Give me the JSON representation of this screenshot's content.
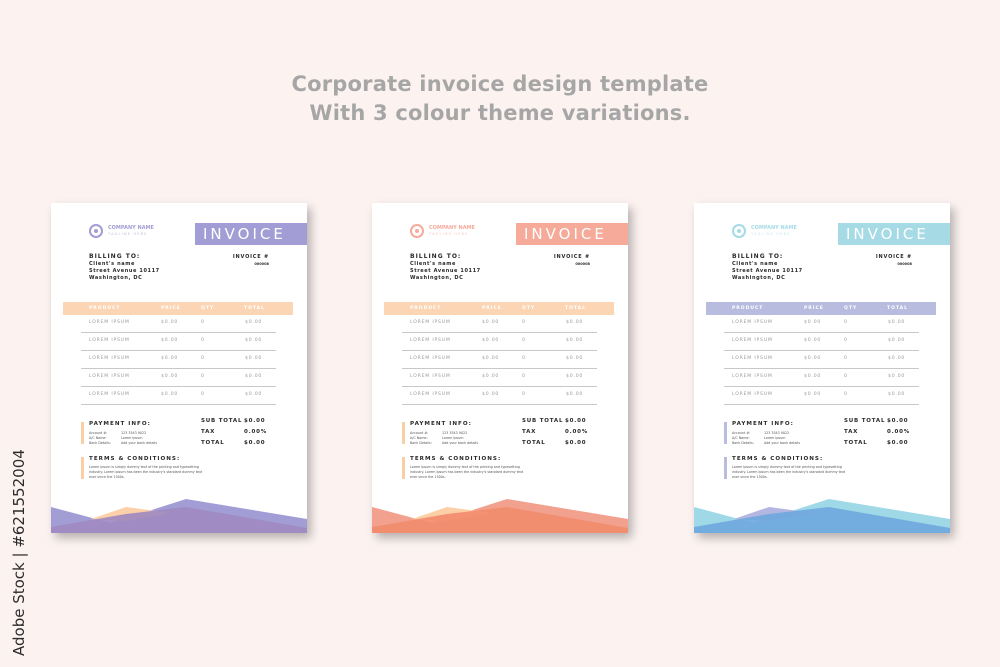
{
  "headline": {
    "line1": "Corporate invoice design template",
    "line2": "With 3 colour theme variations."
  },
  "credit": "Adobe Stock | #621552004",
  "invoice_common": {
    "company_name": "COMPANY NAME",
    "tagline": "TAGLINE HERE",
    "banner_title": "INVOICE",
    "billing_title": "BILLING TO:",
    "billing_lines": [
      "Client's name",
      "Street Avenue 10117",
      "Washington, DC"
    ],
    "invoice_no_label": "INVOICE #",
    "invoice_no_value": "000008",
    "table_headers": [
      "PRODUCT",
      "PRICE",
      "QTY",
      "TOTAL"
    ],
    "rows": [
      [
        "LOREM IPSUM",
        "$0.00",
        "0",
        "$0.00"
      ],
      [
        "LOREM IPSUM",
        "$0.00",
        "0",
        "$0.00"
      ],
      [
        "LOREM IPSUM",
        "$0.00",
        "0",
        "$0.00"
      ],
      [
        "LOREM IPSUM",
        "$0.00",
        "0",
        "$0.00"
      ],
      [
        "LOREM IPSUM",
        "$0.00",
        "0",
        "$0.00"
      ]
    ],
    "payment_title": "PAYMENT INFO:",
    "payment": [
      {
        "k": "Account #:",
        "v": "123 3543 9022"
      },
      {
        "k": "A/C Name:",
        "v": "Lorem Ipsum"
      },
      {
        "k": "Bank Details:",
        "v": "Add your bank details"
      }
    ],
    "terms_title": "TERMS & CONDITIONS:",
    "terms_text": "Lorem Ipsum is simply dummy text of the printing and typesetting industry. Lorem Ipsum has been the industry's standard dummy text ever since the 1500s.",
    "totals": [
      {
        "label": "SUB TOTAL",
        "value": "$0.00"
      },
      {
        "label": "TAX",
        "value": "0.00%"
      },
      {
        "label": "TOTAL",
        "value": "$0.00"
      }
    ]
  },
  "themes": [
    {
      "name": "purple",
      "accent": "#a29dd4",
      "header_bar": "#fcd6b4",
      "side_bar": "#fbcfa6",
      "wave_back": "#a29dd4",
      "wave_mid": "#fcd0a8",
      "wave_front": "#9f8ac0"
    },
    {
      "name": "coral",
      "accent": "#f5aa9a",
      "header_bar": "#fcd6b4",
      "side_bar": "#fbcfa6",
      "wave_back": "#f2a18f",
      "wave_mid": "#fccfa6",
      "wave_front": "#f28c6e"
    },
    {
      "name": "blue",
      "accent": "#a6dbe6",
      "header_bar": "#b8bde0",
      "side_bar": "#b8bde0",
      "wave_back": "#9fd8e6",
      "wave_mid": "#b3b6e0",
      "wave_front": "#6fa8dd"
    }
  ]
}
